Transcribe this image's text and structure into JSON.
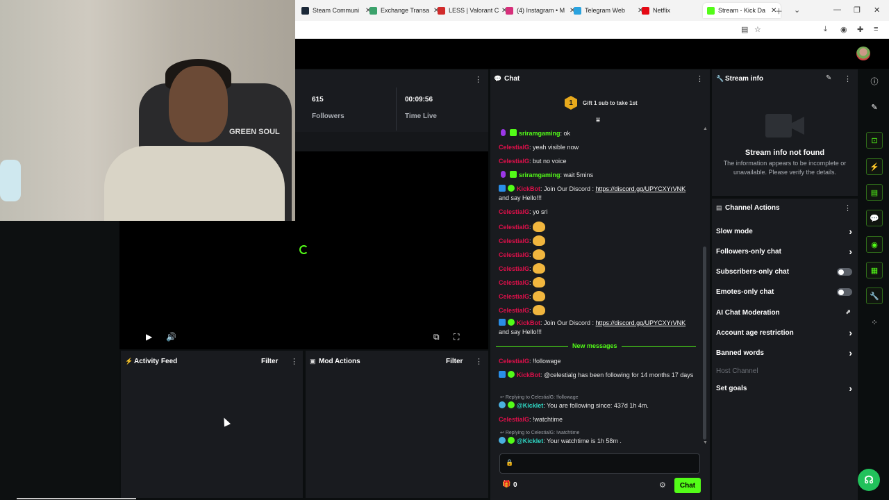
{
  "browser": {
    "tabs": [
      {
        "title": "Steam Communi",
        "favicon_color": "#1b2838"
      },
      {
        "title": "Exchange Transa",
        "favicon_color": "#3ba26b"
      },
      {
        "title": "LESS | Valorant C",
        "favicon_color": "#d12a2a"
      },
      {
        "title": "(4) Instagram • M",
        "favicon_color": "#d62f7a"
      },
      {
        "title": "Telegram Web",
        "favicon_color": "#2aa3df"
      },
      {
        "title": "Netflix",
        "favicon_color": "#e50914"
      },
      {
        "title": "Stream - Kick Da",
        "favicon_color": "#53fc18"
      }
    ]
  },
  "stats": {
    "followers_value": "615",
    "followers_label": "Followers",
    "time_value": "00:09:56",
    "time_label": "Time Live"
  },
  "activity_feed": {
    "title": "Activity Feed",
    "filter": "Filter"
  },
  "mod_actions": {
    "title": "Mod Actions",
    "filter": "Filter"
  },
  "chat": {
    "title": "Chat",
    "gift_badge": "1",
    "gift_text": "Gift 1 sub to take 1st",
    "new_messages_label": "New messages",
    "messages": [
      {
        "user": "sriramgaming",
        "text": ": ok"
      },
      {
        "user": "CelestialG",
        "text": ": yeah visible now"
      },
      {
        "user": "CelestialG",
        "text": ": but no voice"
      },
      {
        "user": "sriramgaming",
        "text": ": wait 5mins"
      },
      {
        "user": "KickBot",
        "text": ": Join Our Discord : ",
        "link": "https://discord.gg/UPYCXYrVNK",
        "suffix": " and say Hello!!!"
      },
      {
        "user": "CelestialG",
        "text": ": yo sri"
      },
      {
        "user": "CelestialG",
        "text": ":"
      },
      {
        "user": "CelestialG",
        "text": ":"
      },
      {
        "user": "CelestialG",
        "text": ":"
      },
      {
        "user": "CelestialG",
        "text": ":"
      },
      {
        "user": "CelestialG",
        "text": ":"
      },
      {
        "user": "CelestialG",
        "text": ":"
      },
      {
        "user": "CelestialG",
        "text": ":"
      },
      {
        "user": "KickBot",
        "text": ": Join Our Discord : ",
        "link": "https://discord.gg/UPYCXYrVNK",
        "suffix": " and say Hello!!!"
      },
      {
        "user": "CelestialG",
        "text": ": !followage"
      },
      {
        "user": "KickBot",
        "text": ": @celestialg has been following for 14 months 17 days"
      },
      {
        "user": "@Kicklet",
        "text": ": You are following since: 437d 1h 4m.",
        "reply": "Replying to CelestialG: !followage"
      },
      {
        "user": "CelestialG",
        "text": ": !watchtime"
      },
      {
        "user": "@Kicklet",
        "text": ": Your watchtime is 1h 58m .",
        "reply": "Replying to CelestialG: !watchtime"
      }
    ],
    "viewer_count": "0",
    "send_label": "Chat"
  },
  "stream_info": {
    "title": "Stream info",
    "heading": "Stream info not found",
    "description": "The information appears to be incomplete or unavailable. Please verify the details."
  },
  "channel_actions": {
    "title": "Channel Actions",
    "items": [
      {
        "label": "Slow mode"
      },
      {
        "label": "Followers-only chat"
      },
      {
        "label": "Subscribers-only chat"
      },
      {
        "label": "Emotes-only chat"
      },
      {
        "label": "AI Chat Moderation"
      },
      {
        "label": "Account age restriction"
      },
      {
        "label": "Banned words"
      },
      {
        "label": "Host Channel"
      },
      {
        "label": "Set goals"
      }
    ]
  },
  "webcam": {
    "chair_brand": "GREEN SOUL"
  },
  "colors": {
    "accent": "#53fc18",
    "panel": "#191b1f",
    "username_red": "#e0104b"
  }
}
